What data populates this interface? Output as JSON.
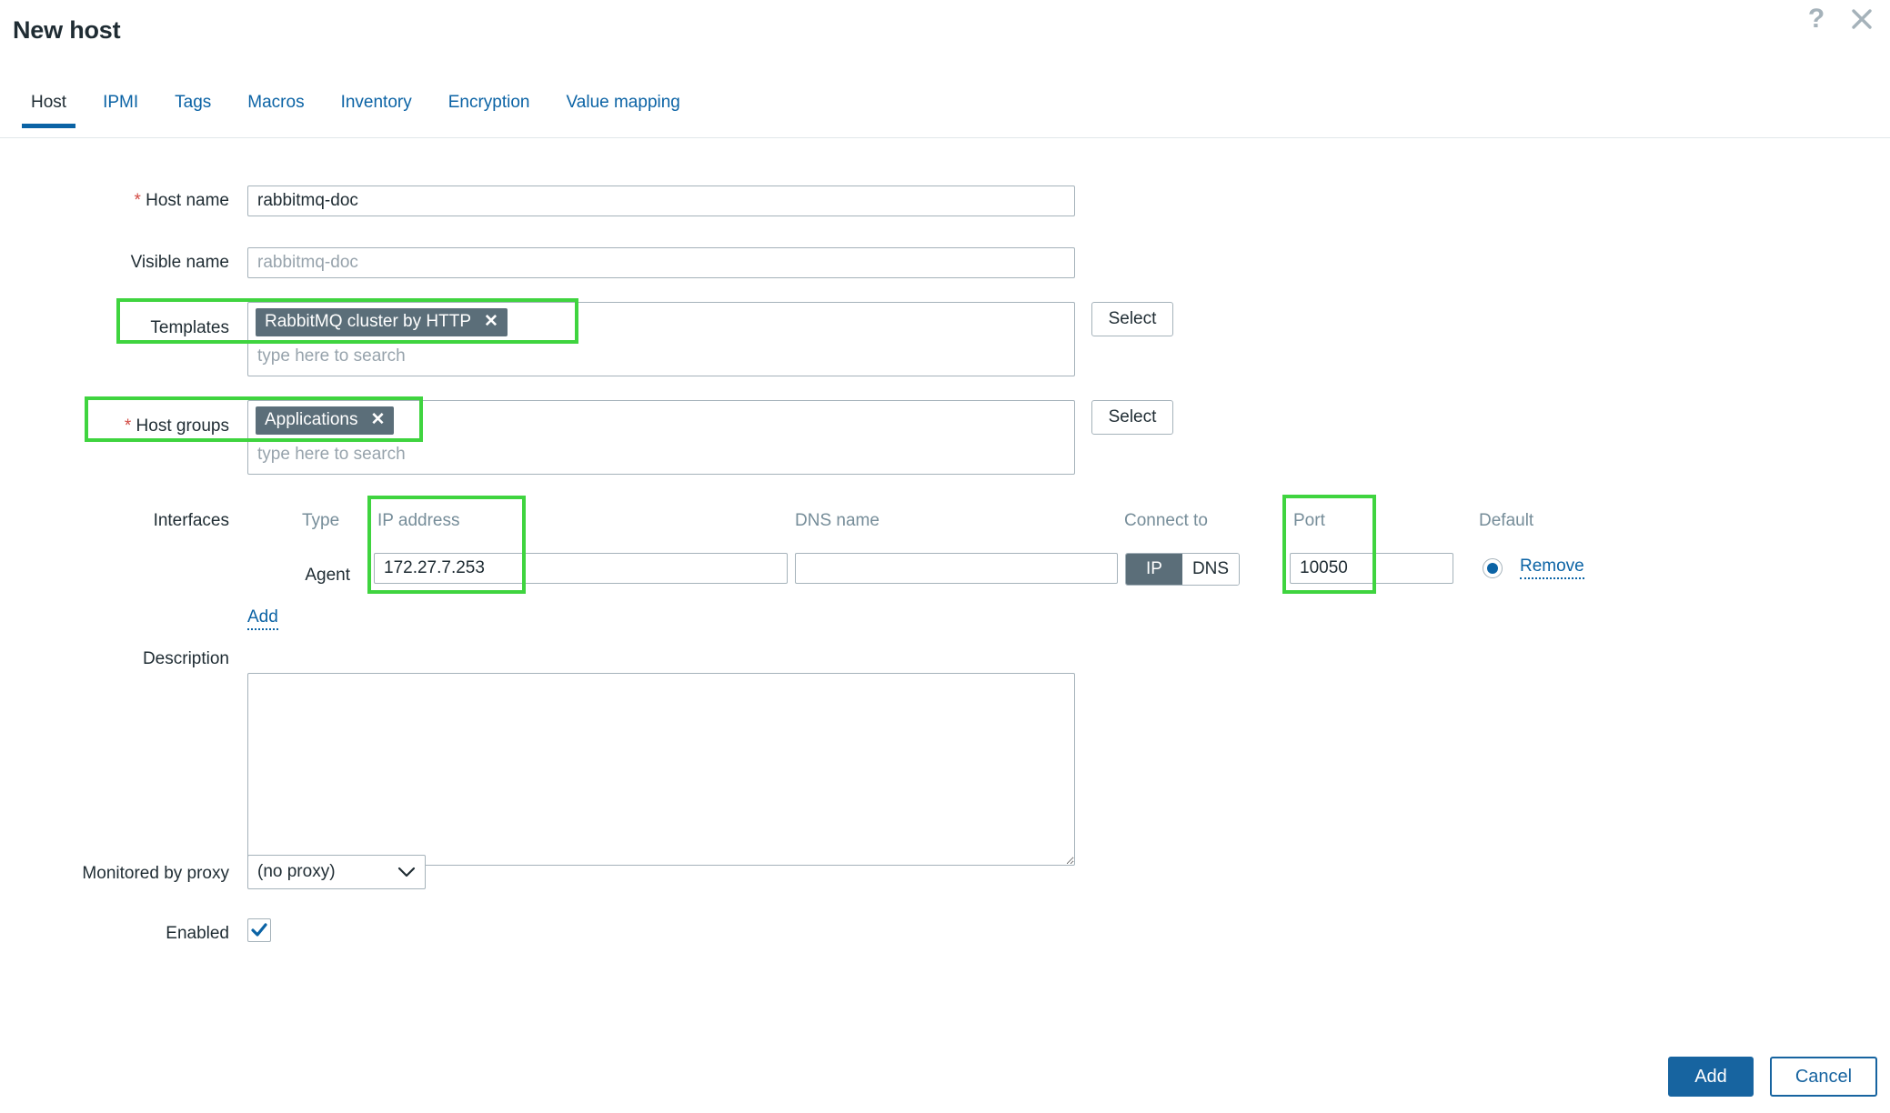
{
  "header": {
    "title": "New host",
    "help_icon": "question-mark-icon",
    "close_icon": "close-icon"
  },
  "tabs": [
    {
      "label": "Host",
      "active": true
    },
    {
      "label": "IPMI",
      "active": false
    },
    {
      "label": "Tags",
      "active": false
    },
    {
      "label": "Macros",
      "active": false
    },
    {
      "label": "Inventory",
      "active": false
    },
    {
      "label": "Encryption",
      "active": false
    },
    {
      "label": "Value mapping",
      "active": false
    }
  ],
  "form": {
    "host_name": {
      "label": "Host name",
      "required": "*",
      "value": "rabbitmq-doc",
      "placeholder": ""
    },
    "visible_name": {
      "label": "Visible name",
      "value": "",
      "placeholder": "rabbitmq-doc"
    },
    "templates": {
      "label": "Templates",
      "chips": [
        "RabbitMQ cluster by HTTP"
      ],
      "search_placeholder": "type here to search",
      "select_button": "Select"
    },
    "host_groups": {
      "label": "Host groups",
      "required": "*",
      "chips": [
        "Applications"
      ],
      "search_placeholder": "type here to search",
      "select_button": "Select"
    },
    "interfaces": {
      "label": "Interfaces",
      "columns": {
        "type": "Type",
        "ip_address": "IP address",
        "dns_name": "DNS name",
        "connect_to": "Connect to",
        "port": "Port",
        "default": "Default"
      },
      "rows": [
        {
          "type": "Agent",
          "ip_address": "172.27.7.253",
          "dns_name": "",
          "connect_to_selected": "IP",
          "connect_to_options": [
            "IP",
            "DNS"
          ],
          "port": "10050",
          "default_selected": true,
          "remove_label": "Remove"
        }
      ],
      "add_label": "Add"
    },
    "description": {
      "label": "Description",
      "value": "",
      "placeholder": ""
    },
    "monitored_by_proxy": {
      "label": "Monitored by proxy",
      "value": "(no proxy)",
      "options": [
        "(no proxy)"
      ]
    },
    "enabled": {
      "label": "Enabled",
      "checked": true
    }
  },
  "footer": {
    "add_label": "Add",
    "cancel_label": "Cancel"
  },
  "colors": {
    "accent_blue": "#0b63a5",
    "button_blue": "#1764a0",
    "chip_gray": "#5b6e79",
    "required_red": "#d24a43",
    "highlight_green": "#3fd43f",
    "muted_text": "#768d99",
    "border_gray": "#a5b2ba"
  },
  "annotations": {
    "highlight_boxes": [
      "templates-field",
      "host-groups-field",
      "ip-address-column",
      "port-column"
    ]
  }
}
